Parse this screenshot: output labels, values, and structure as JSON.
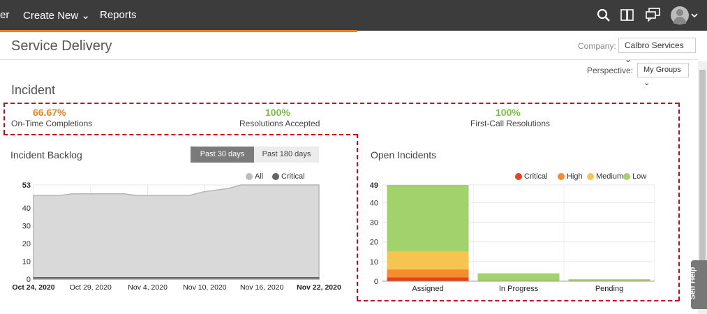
{
  "topbar": {
    "nav": [
      "er",
      "Create New ⌄",
      "Reports"
    ],
    "icons": [
      "search-icon",
      "book-icon",
      "chat-icon",
      "avatar"
    ]
  },
  "header": {
    "title": "Service Delivery",
    "company_label": "Company:",
    "company_value": "Calbro Services ⌄",
    "perspective_label": "Perspective:",
    "perspective_value": "My Groups ⌄"
  },
  "incident": {
    "title": "Incident",
    "metrics": [
      {
        "value": "66.67%",
        "label": "On-Time Completions",
        "color": "#f48120"
      },
      {
        "value": "100%",
        "label": "Resolutions Accepted",
        "color": "#7ac143"
      },
      {
        "value": "100%",
        "label": "First-Call Resolutions",
        "color": "#7ac143"
      }
    ]
  },
  "backlog": {
    "title": "Incident Backlog",
    "btn_30": "Past 30 days",
    "btn_180": "Past 180 days",
    "legend_all": "All",
    "legend_critical": "Critical"
  },
  "open": {
    "title": "Open Incidents",
    "legend": [
      "Critical",
      "High",
      "Medium",
      "Low"
    ]
  },
  "self_help": "Self Help",
  "colors": {
    "accent": "#f48120",
    "critical": "#e8411c",
    "high": "#f58d2a",
    "medium": "#f5c451",
    "low": "#a2d26c"
  },
  "chart_data": [
    {
      "type": "area",
      "x": [
        "Oct 24, 2020",
        "Oct 29, 2020",
        "Nov 4, 2020",
        "Nov 10, 2020",
        "Nov 16, 2020",
        "Nov 22, 2020"
      ],
      "xlabels_bold": [
        "Oct 24, 2020",
        "Nov 22, 2020"
      ],
      "ylim": [
        0,
        53
      ],
      "yticks": [
        0,
        10,
        20,
        30,
        40,
        53
      ],
      "series": [
        {
          "name": "All",
          "values": [
            47,
            47,
            47,
            48,
            48,
            48,
            48,
            48,
            47,
            47,
            47,
            47,
            47,
            49,
            50,
            51,
            53,
            53,
            53,
            53,
            53,
            53,
            53
          ]
        },
        {
          "name": "Critical",
          "values": [
            1,
            1,
            1,
            1,
            1,
            1,
            1,
            1,
            1,
            1,
            1,
            1,
            1,
            1,
            1,
            1,
            1,
            1,
            1,
            1,
            1,
            1,
            1
          ]
        }
      ]
    },
    {
      "type": "bar",
      "categories": [
        "Assigned",
        "In Progress",
        "Pending"
      ],
      "ylim": [
        0,
        49
      ],
      "yticks": [
        0,
        10,
        20,
        30,
        40,
        49
      ],
      "series": [
        {
          "name": "Critical",
          "values": [
            2,
            0,
            0
          ]
        },
        {
          "name": "High",
          "values": [
            4,
            0,
            0
          ]
        },
        {
          "name": "Medium",
          "values": [
            9,
            0,
            0
          ]
        },
        {
          "name": "Low",
          "values": [
            34,
            4,
            1
          ]
        }
      ]
    }
  ]
}
